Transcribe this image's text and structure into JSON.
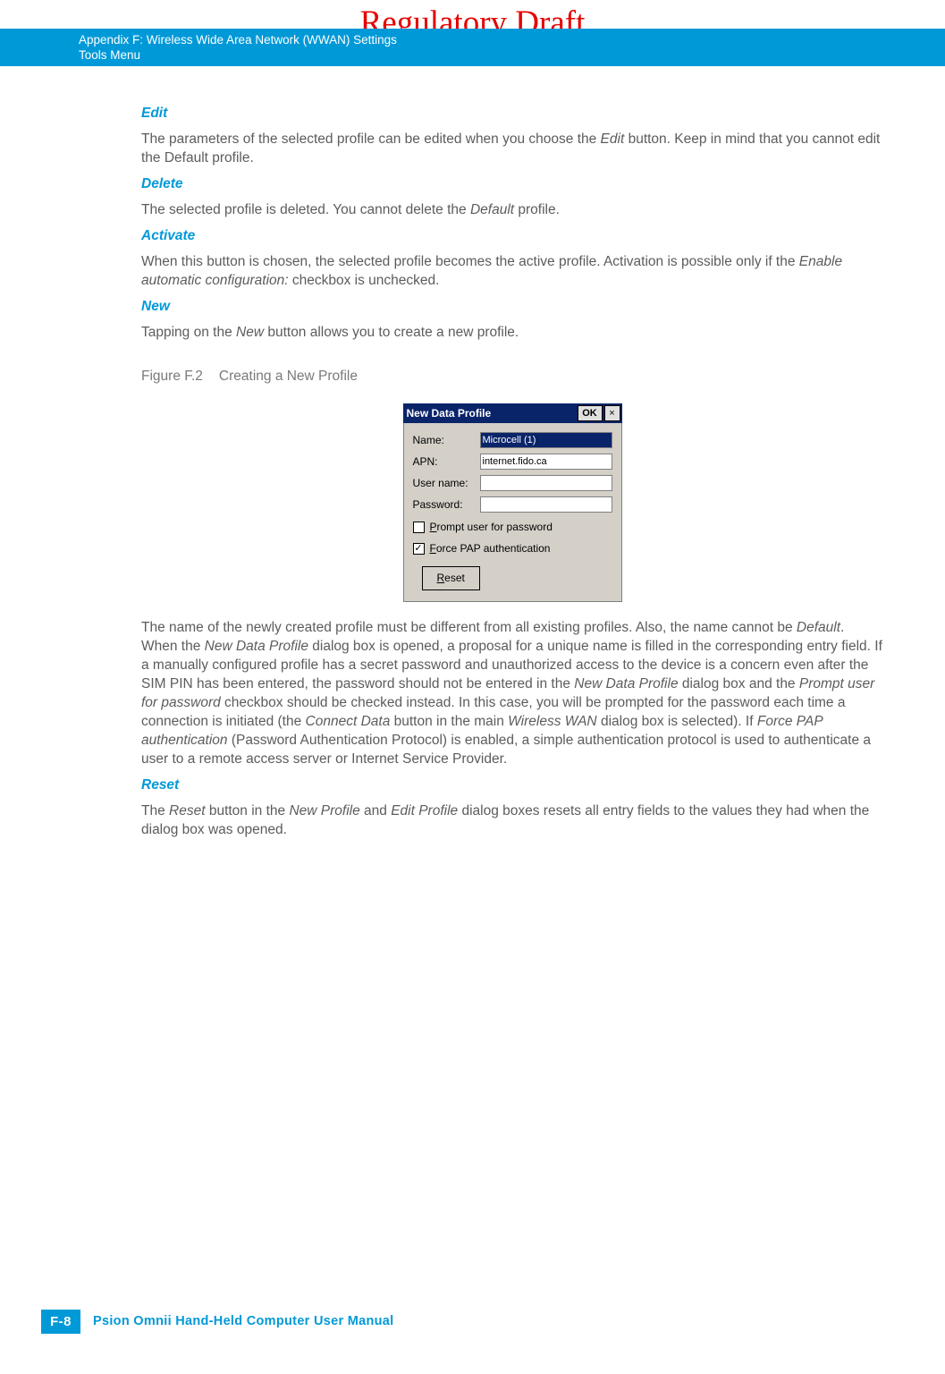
{
  "watermark": "Regulatory Draft",
  "header": {
    "line1": "Appendix F: Wireless Wide Area Network (WWAN) Settings",
    "line2": "Tools Menu"
  },
  "sections": {
    "edit": {
      "title": "Edit",
      "p1a": "The parameters of the selected profile can be edited when you choose the ",
      "p1b": "Edit",
      "p1c": " button. Keep in mind that you cannot edit the Default profile."
    },
    "delete": {
      "title": "Delete",
      "p1a": "The selected profile is deleted. You cannot delete the ",
      "p1b": "Default",
      "p1c": " profile."
    },
    "activate": {
      "title": "Activate",
      "p1a": "When this button is chosen, the selected profile becomes the active profile. Activation is possible only if the ",
      "p1b": "Enable automatic configuration:",
      "p1c": " checkbox is unchecked."
    },
    "new": {
      "title": "New",
      "p1a": "Tapping on the ",
      "p1b": "New",
      "p1c": " button allows you to create a new profile."
    },
    "figure": {
      "num": "Figure F.2",
      "title": "Creating a New Profile"
    },
    "dialog": {
      "title": "New Data Profile",
      "ok": "OK",
      "close": "×",
      "name_label": "Name:",
      "name_value": "Microcell (1)",
      "apn_label": "APN:",
      "apn_value": "internet.fido.ca",
      "user_label": "User name:",
      "user_value": "",
      "pass_label": "Password:",
      "pass_value": "",
      "prompt_u": "P",
      "prompt_rest": "rompt user for password",
      "force_u": "F",
      "force_rest": "orce PAP authentication",
      "reset_u": "R",
      "reset_rest": "eset"
    },
    "after": {
      "p1a": "The name of the newly created profile must be different from all existing profiles. Also, the name cannot be ",
      "p1b": "Default",
      "p1c": ". When the ",
      "p1d": "New Data Profile",
      "p1e": " dialog box is opened, a proposal for a unique name is filled in the corresponding entry field. If a manually configured profile has a secret password and unauthorized access to the device is a concern even after the SIM PIN has been entered, the password should not be entered in the ",
      "p1f": "New Data Profile",
      "p1g": " dialog box and the ",
      "p1h": "Prompt user for password",
      "p1i": " checkbox should be checked instead. In this case, you will be prompted for the password each time a connection is initiated (the ",
      "p1j": "Connect Data",
      "p1k": " button in the main ",
      "p1l": "Wireless WAN",
      "p1m": " dialog box is selected). If ",
      "p1n": "Force PAP authentication",
      "p1o": " (Password Authentication Protocol) is enabled, a simple authentication protocol is used to authenticate a user to a remote access server or Internet Service Provider."
    },
    "reset": {
      "title": "Reset",
      "p1a": "The ",
      "p1b": "Reset",
      "p1c": " button in the ",
      "p1d": "New Profile",
      "p1e": " and ",
      "p1f": "Edit Profile",
      "p1g": " dialog boxes resets all entry fields to the values they had when the dialog box was opened."
    }
  },
  "footer": {
    "page": "F-8",
    "title": "Psion Omnii Hand-Held Computer User Manual"
  }
}
